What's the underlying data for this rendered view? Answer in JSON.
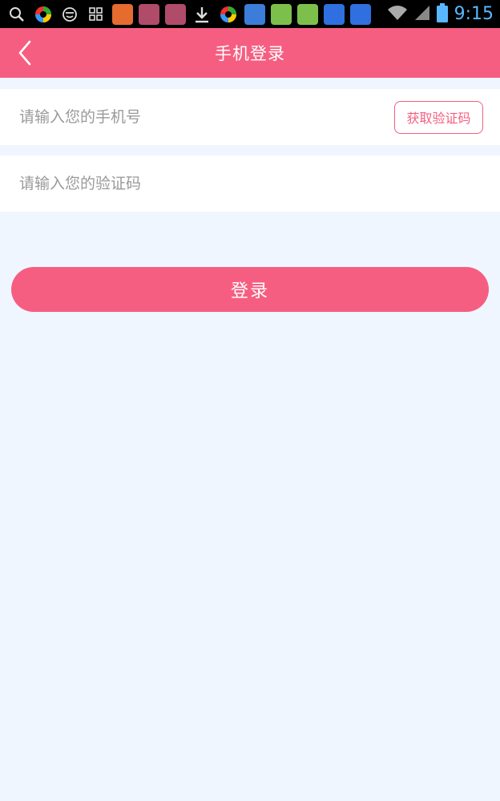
{
  "status_bar": {
    "time": "9:15",
    "icons": [
      "search-icon",
      "colorful-app-icon",
      "smiley-icon",
      "apps-grid-icon",
      "app-tile-icon",
      "music-app-icon",
      "music-app-icon",
      "download-icon",
      "colorful-app-icon",
      "notes-app-icon",
      "games-app-icon",
      "games-app-icon",
      "baidu-icon",
      "baidu-icon",
      "wifi-icon",
      "signal-icon",
      "battery-icon"
    ]
  },
  "header": {
    "title": "手机登录"
  },
  "form": {
    "phone_placeholder": "请输入您的手机号",
    "get_code_label": "获取验证码",
    "code_placeholder": "请输入您的验证码",
    "login_label": "登录"
  },
  "colors": {
    "accent": "#f65e81",
    "background": "#f0f6ff"
  }
}
